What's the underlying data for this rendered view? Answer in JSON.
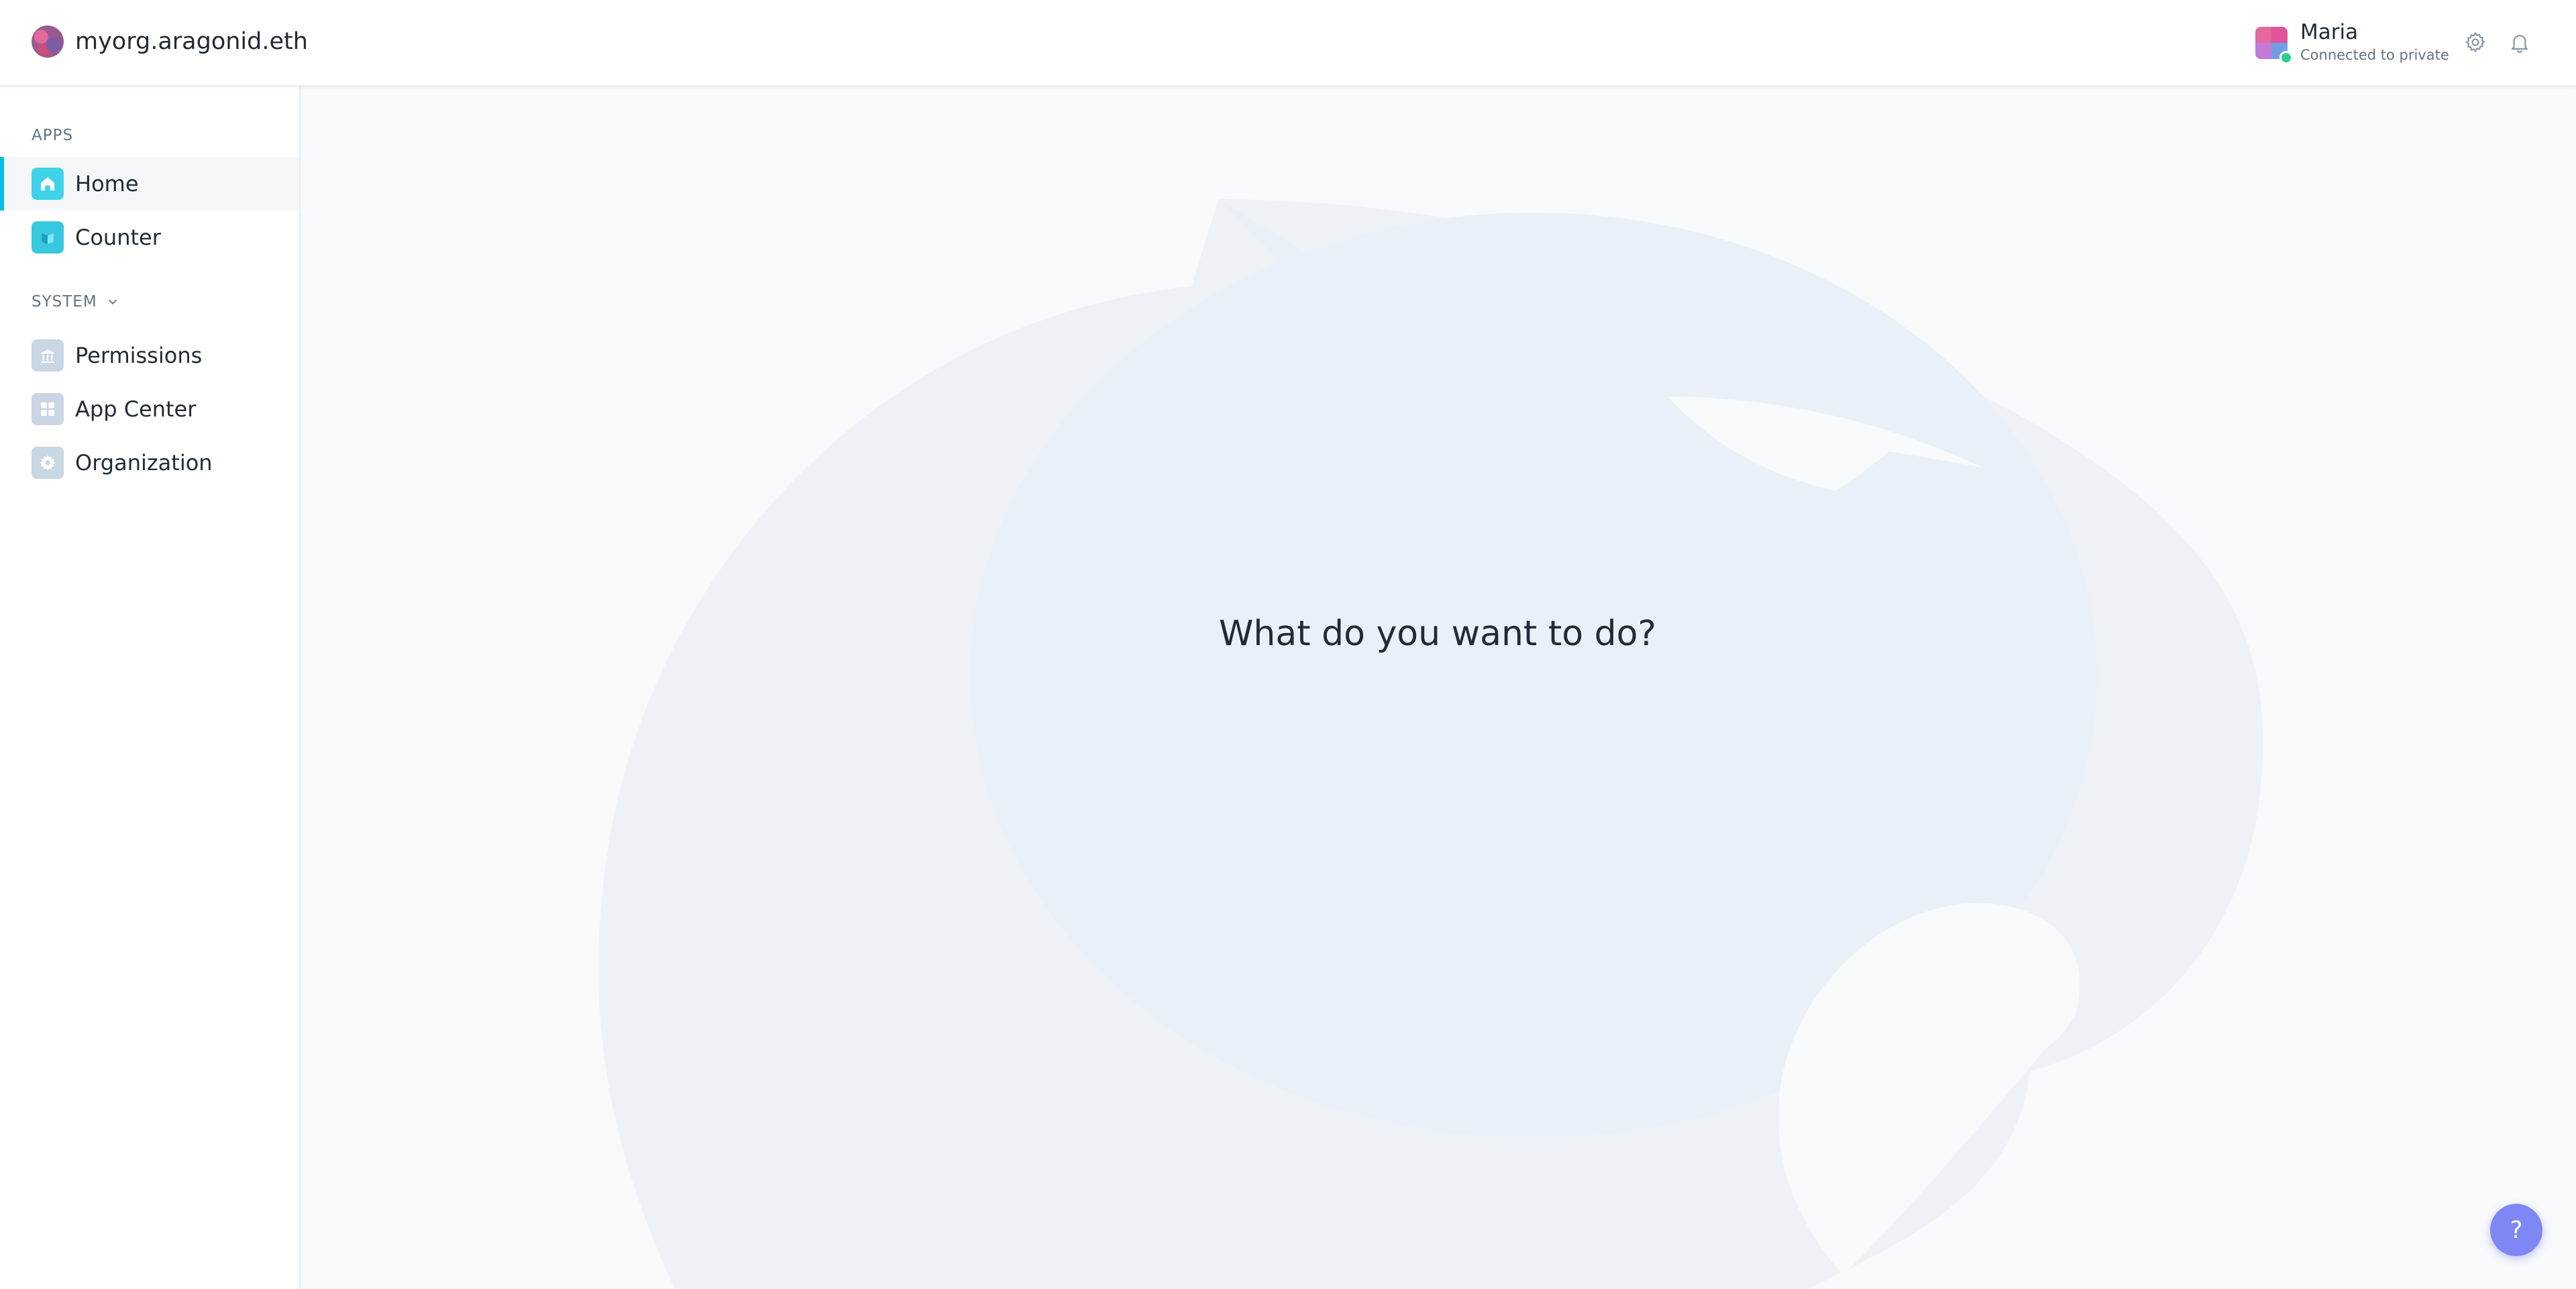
{
  "header": {
    "org_name": "myorg.aragonid.eth",
    "user": {
      "name": "Maria",
      "network": "Connected to private"
    },
    "icons": [
      "settings-icon",
      "notifications-icon"
    ]
  },
  "sidebar": {
    "apps_label": "APPS",
    "apps": [
      {
        "label": "Home",
        "icon": "home-icon",
        "active": true
      },
      {
        "label": "Counter",
        "icon": "counter-icon",
        "active": false
      }
    ],
    "system_label": "SYSTEM",
    "system": [
      {
        "label": "Permissions",
        "icon": "permissions-icon"
      },
      {
        "label": "App Center",
        "icon": "app-center-icon"
      },
      {
        "label": "Organization",
        "icon": "organization-icon"
      }
    ]
  },
  "main": {
    "headline": "What do you want to do?"
  },
  "help": {
    "label": "?"
  },
  "colors": {
    "accent": "#08bee5",
    "help_button": "#7f86f5",
    "background": "#f7f9fb",
    "watermark": "#eaf0f6"
  }
}
